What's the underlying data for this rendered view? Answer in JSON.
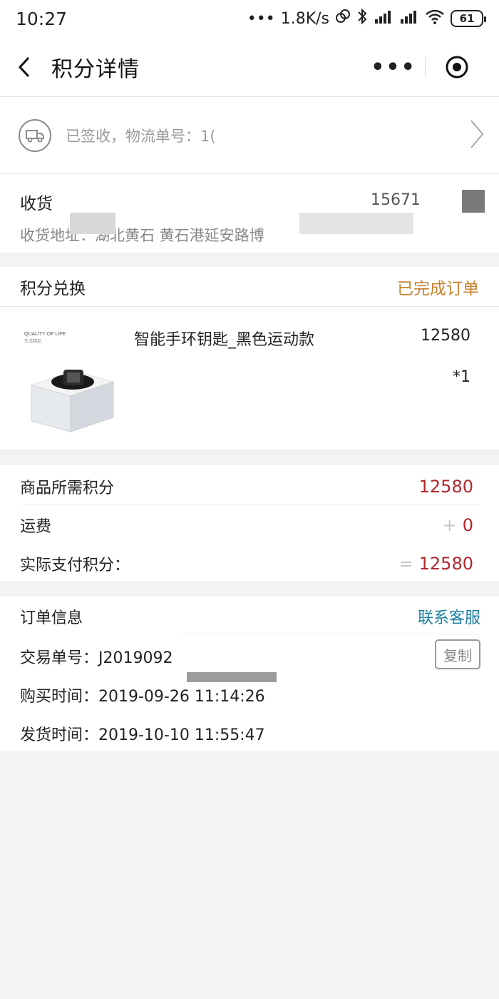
{
  "status_bar": {
    "time": "10:27",
    "network_speed": "1.8K/s",
    "battery": "61"
  },
  "nav": {
    "title": "积分详情",
    "more": "•••"
  },
  "logistics": {
    "text": "已签收，物流单号：1("
  },
  "address": {
    "name": "收货",
    "phone": "15671",
    "detail": "收货地址：湖北黄石 黄石港延安路博"
  },
  "exchange": {
    "title": "积分兑换",
    "status": "已完成订单",
    "status_color": "#c8822e"
  },
  "product": {
    "name": "智能手环钥匙_黑色运动款",
    "price": "12580",
    "quantity": "*1",
    "thumb_label": "QUALITY OF LIFE",
    "thumb_sub": "生活精品"
  },
  "points": {
    "required_label": "商品所需积分",
    "required_value": "12580",
    "shipping_label": "运费",
    "shipping_op": "+",
    "shipping_value": "0",
    "actual_label": "实际支付积分：",
    "actual_op": "=",
    "actual_value": "12580",
    "value_color": "#b0272d"
  },
  "order": {
    "title": "订单信息",
    "contact": "联系客服",
    "contact_color": "#1e7fa0",
    "trade_no": "交易单号：J2019092",
    "copy": "复制",
    "purchase_time": "购买时间：2019-09-26 11:14:26",
    "ship_time": "发货时间：2019-10-10 11:55:47"
  }
}
